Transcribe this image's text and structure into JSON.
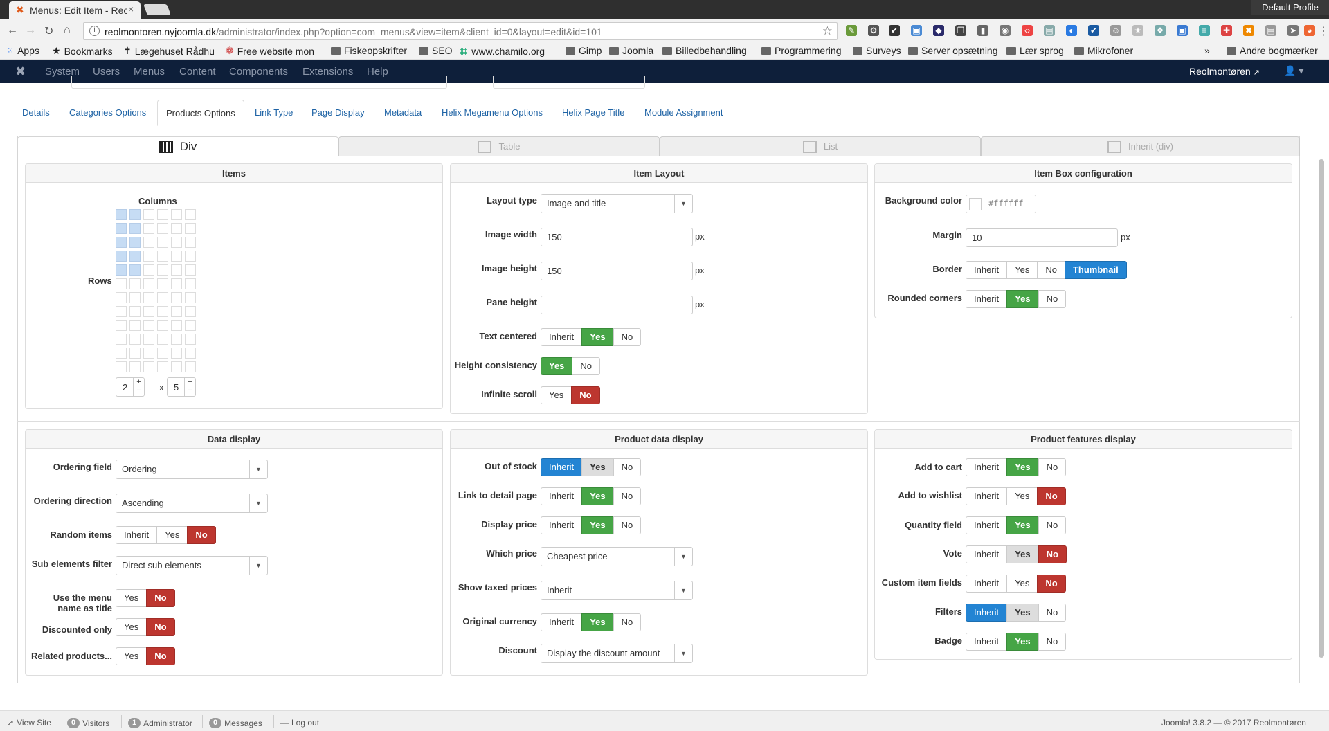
{
  "browser": {
    "tab_title": "Menus: Edit Item - Reolmontøren",
    "profile": "Default Profile",
    "url_host": "reolmontoren.nyjoomla.dk",
    "url_path": "/administrator/index.php?option=com_menus&view=item&client_id=0&layout=edit&id=101",
    "bookmarks": [
      "Apps",
      "Bookmarks",
      "Lægehuset Rådhu",
      "Free website mon",
      "Fiskeopskrifter",
      "SEO",
      "www.chamilo.org",
      "Gimp",
      "Joomla",
      "Billedbehandling",
      "Programmering",
      "Surveys",
      "Server opsætning",
      "Lær sprog",
      "Mikrofoner"
    ],
    "other_bookmarks": "Andre bogmærker"
  },
  "joomla": {
    "menu": [
      "System",
      "Users",
      "Menus",
      "Content",
      "Components",
      "Extensions",
      "Help"
    ],
    "site_link": "Reolmontøren",
    "user_icon": "user-icon"
  },
  "tabs": [
    "Details",
    "Categories Options",
    "Products Options",
    "Link Type",
    "Page Display",
    "Metadata",
    "Helix Megamenu Options",
    "Helix Page Title",
    "Module Assignment"
  ],
  "active_tab": "Products Options",
  "view_tabs": [
    "Div",
    "Table",
    "List",
    "Inherit (div)"
  ],
  "items": {
    "title": "Items",
    "columns_label": "Columns",
    "rows_label": "Rows",
    "cols_value": "2",
    "rows_value": "5",
    "times": "x"
  },
  "item_layout": {
    "title": "Item Layout",
    "layout_type_label": "Layout type",
    "layout_type_value": "Image and title",
    "image_width_label": "Image width",
    "image_width_value": "150",
    "image_height_label": "Image height",
    "image_height_value": "150",
    "pane_height_label": "Pane height",
    "pane_height_value": "",
    "unit": "px",
    "text_centered_label": "Text centered",
    "height_consistency_label": "Height consistency",
    "infinite_scroll_label": "Infinite scroll"
  },
  "box_config": {
    "title": "Item Box configuration",
    "bg_label": "Background color",
    "bg_value": "#ffffff",
    "margin_label": "Margin",
    "margin_value": "10",
    "unit": "px",
    "border_label": "Border",
    "rounded_label": "Rounded corners"
  },
  "data_display": {
    "title": "Data display",
    "ordering_field_label": "Ordering field",
    "ordering_field_value": "Ordering",
    "ordering_direction_label": "Ordering direction",
    "ordering_direction_value": "Ascending",
    "random_label": "Random items",
    "sub_label": "Sub elements filter",
    "sub_value": "Direct sub elements",
    "menu_name_label_1": "Use the menu",
    "menu_name_label_2": "name as title",
    "discounted_label": "Discounted only",
    "related_label": "Related products..."
  },
  "product_data": {
    "title": "Product data display",
    "out_of_stock_label": "Out of stock",
    "link_detail_label": "Link to detail page",
    "display_price_label": "Display price",
    "which_price_label": "Which price",
    "which_price_value": "Cheapest price",
    "taxed_label": "Show taxed prices",
    "taxed_value": "Inherit",
    "currency_label": "Original currency",
    "discount_label": "Discount",
    "discount_value": "Display the discount amount"
  },
  "features": {
    "title": "Product features display",
    "add_to_cart": "Add to cart",
    "wishlist": "Add to wishlist",
    "quantity": "Quantity field",
    "vote": "Vote",
    "custom": "Custom item fields",
    "filters": "Filters",
    "badge": "Badge"
  },
  "opts": {
    "inherit": "Inherit",
    "yes": "Yes",
    "no": "No",
    "thumbnail": "Thumbnail"
  },
  "footer": {
    "view_site": "View Site",
    "visitors_count": "0",
    "visitors": "Visitors",
    "admin_count": "1",
    "admin": "Administrator",
    "messages_count": "0",
    "messages": "Messages",
    "logout": "Log out",
    "version": "Joomla! 3.8.2  —  © 2017 Reolmontøren"
  },
  "colors": {
    "yes": "#46a546",
    "no": "#bd362f",
    "blue": "#2384d3",
    "header": "#0e1f3a"
  }
}
